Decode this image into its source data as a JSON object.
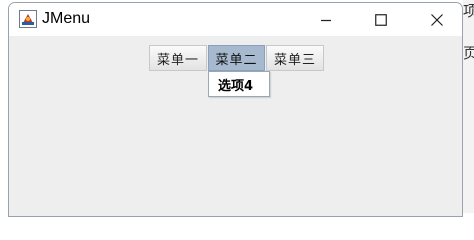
{
  "window": {
    "title": "JMenu"
  },
  "menubar": {
    "menus": [
      {
        "label": "菜单一"
      },
      {
        "label": "菜单二"
      },
      {
        "label": "菜单三"
      }
    ]
  },
  "popup": {
    "items": [
      {
        "label": "选项4"
      }
    ]
  },
  "background": {
    "glyphs": [
      "项",
      "页"
    ]
  },
  "colors": {
    "selected_menu": "#a6b9cf",
    "window_bg": "#eeeeee"
  }
}
